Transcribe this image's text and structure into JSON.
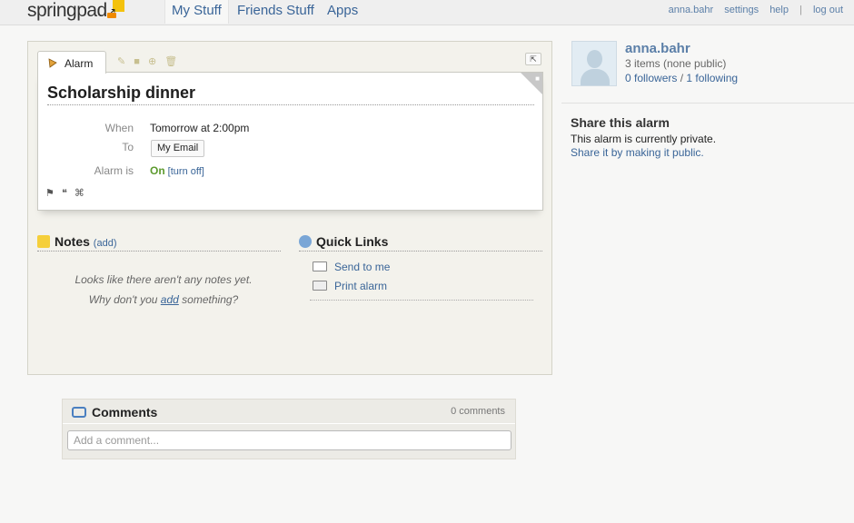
{
  "app": {
    "logo_text": "springpad",
    "brand_color": "#f4c20d"
  },
  "nav": {
    "tabs": [
      {
        "label": "My Stuff",
        "active": true
      },
      {
        "label": "Friends Stuff",
        "active": false
      },
      {
        "label": "Apps",
        "active": false
      }
    ],
    "user_links": {
      "username": "anna.bahr",
      "settings": "settings",
      "help": "help",
      "separator": "|",
      "logout": "log out"
    }
  },
  "card": {
    "tab_label": "Alarm",
    "tab_icon": "alarm-bell-icon",
    "tools": [
      "pencil-icon",
      "lock-icon",
      "add-to-icon",
      "trash-icon"
    ],
    "collapse_icon": "collapse-icon",
    "title": "Scholarship dinner",
    "fields": {
      "when_label": "When",
      "when_value": "Tomorrow at 2:00pm",
      "to_label": "To",
      "to_value": "My Email",
      "alarm_label": "Alarm is",
      "alarm_state": "On",
      "alarm_toggle": "[turn off]"
    },
    "footer_icons": [
      "flag-icon",
      "quote-icon",
      "tag-icon"
    ]
  },
  "notes": {
    "heading": "Notes",
    "add_label": "(add)",
    "empty_line1": "Looks like there aren't any notes yet.",
    "empty_line2_pre": "Why don't you",
    "empty_line2_link": "add",
    "empty_line2_post": "something?"
  },
  "quick_links": {
    "heading": "Quick Links",
    "items": [
      {
        "label": "Send to me",
        "icon": "envelope-icon"
      },
      {
        "label": "Print alarm",
        "icon": "printer-icon"
      }
    ]
  },
  "profile": {
    "name": "anna.bahr",
    "items": "3 items (none public)",
    "followers": "0 followers",
    "sep": "/",
    "following": "1 following"
  },
  "share": {
    "heading": "Share this alarm",
    "status": "This alarm is currently private.",
    "link": "Share it by making it public."
  },
  "comments": {
    "heading": "Comments",
    "count": "0 comments",
    "placeholder": "Add a comment..."
  }
}
